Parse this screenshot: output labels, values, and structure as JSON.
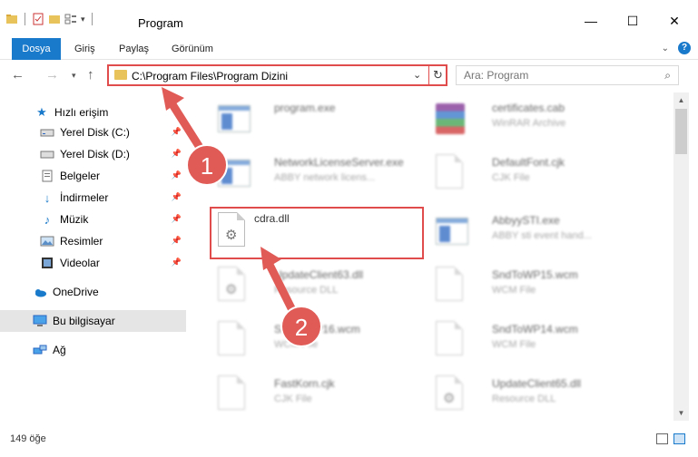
{
  "window": {
    "title": "Program"
  },
  "ribbon": {
    "tabs": [
      "Dosya",
      "Giriş",
      "Paylaş",
      "Görünüm"
    ]
  },
  "address": {
    "path": "C:\\Program Files\\Program Dizini"
  },
  "search": {
    "placeholder": "Ara: Program"
  },
  "sidebar": {
    "quick_access": "Hızlı erişim",
    "items": [
      {
        "label": "Yerel Disk (C:)",
        "icon": "drive-icon"
      },
      {
        "label": "Yerel Disk (D:)",
        "icon": "drive-icon"
      },
      {
        "label": "Belgeler",
        "icon": "documents-icon"
      },
      {
        "label": "İndirmeler",
        "icon": "download-icon"
      },
      {
        "label": "Müzik",
        "icon": "music-icon"
      },
      {
        "label": "Resimler",
        "icon": "pictures-icon"
      },
      {
        "label": "Videolar",
        "icon": "videos-icon"
      }
    ],
    "onedrive": "OneDrive",
    "this_pc": "Bu bilgisayar",
    "network": "Ağ"
  },
  "files": {
    "left": [
      {
        "name": "program.exe",
        "type": ""
      },
      {
        "name": "NetworkLicenseServer.exe",
        "type": "ABBY network licens..."
      },
      {
        "name": "cdra.dll",
        "type": ""
      },
      {
        "name": "UpdateClient63.dll",
        "type": "Resource DLL"
      },
      {
        "name": "SndToWP16.wcm",
        "type": "WCM File"
      },
      {
        "name": "FastKorn.cjk",
        "type": "CJK File"
      }
    ],
    "right": [
      {
        "name": "certificates.cab",
        "type": "WinRAR Archive"
      },
      {
        "name": "DefaultFont.cjk",
        "type": "CJK File"
      },
      {
        "name": "AbbyySTI.exe",
        "type": "ABBY sti event hand..."
      },
      {
        "name": "SndToWP15.wcm",
        "type": "WCM File"
      },
      {
        "name": "SndToWP14.wcm",
        "type": "WCM File"
      },
      {
        "name": "UpdateClient65.dll",
        "type": "Resource DLL"
      }
    ]
  },
  "status": {
    "count": "149 öğe"
  },
  "annotations": {
    "step1": "1",
    "step2": "2"
  },
  "colors": {
    "accent": "#1979ca",
    "highlight": "#e04b4b",
    "arrow": "#e05a56"
  }
}
